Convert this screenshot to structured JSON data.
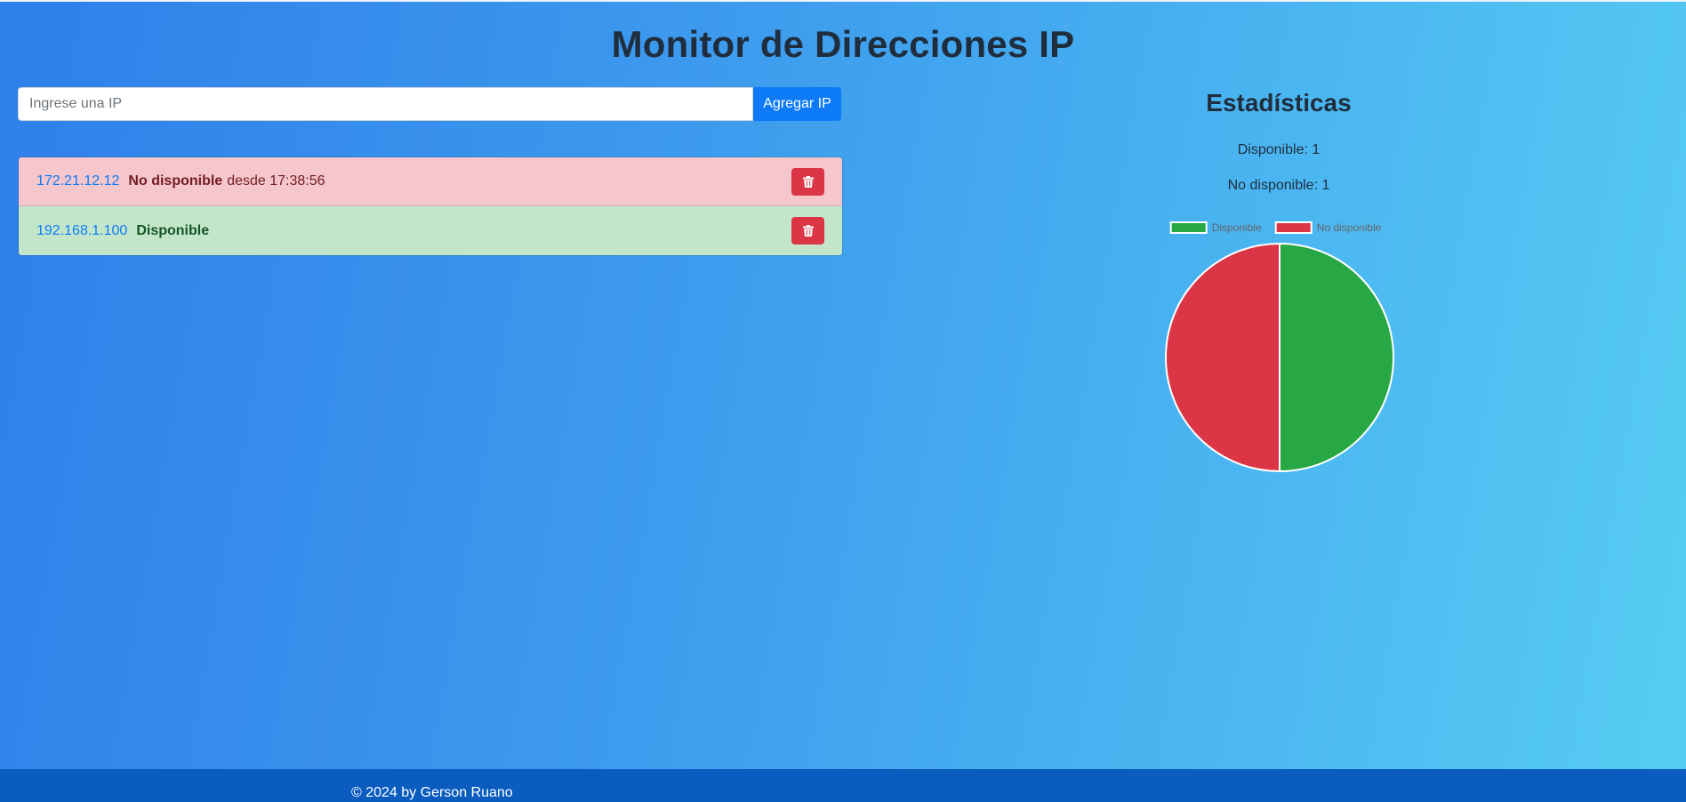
{
  "page": {
    "title": "Monitor de Direcciones IP"
  },
  "form": {
    "placeholder": "Ingrese una IP",
    "add_label": "Agregar IP"
  },
  "ip_list": [
    {
      "ip": "172.21.12.12",
      "status": "No disponible",
      "since": "desde 17:38:56",
      "state": "down",
      "delete_icon": "trash-icon"
    },
    {
      "ip": "192.168.1.100",
      "status": "Disponible",
      "since": "",
      "state": "up",
      "delete_icon": "trash-icon"
    }
  ],
  "stats": {
    "title": "Estadísticas",
    "available_text": "Disponible: 1",
    "unavailable_text": "No disponible: 1"
  },
  "chart_data": {
    "type": "pie",
    "title": "",
    "labels": [
      "Disponible",
      "No disponible"
    ],
    "values": [
      1,
      1
    ],
    "colors": [
      "#28a745",
      "#dc3545"
    ],
    "legend": "top"
  },
  "footer": {
    "text": "© 2024 by Gerson Ruano"
  },
  "colors": {
    "accent": "#0d7bf7",
    "danger": "#dc3545",
    "success": "#28a745",
    "footer": "#0a5cbf"
  }
}
